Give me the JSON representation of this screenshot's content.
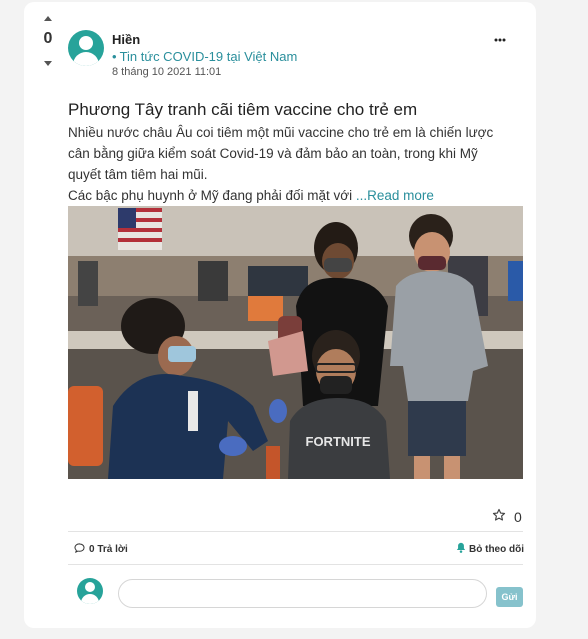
{
  "vote": {
    "count": "0"
  },
  "post": {
    "author": "Hiền",
    "category": "Tin tức COVID-19 tại Việt Nam",
    "category_bullet": "•",
    "date": "8 tháng 10 2021 11:01",
    "more_label": "•••",
    "title": "Phương Tây tranh cãi tiêm vaccine cho trẻ em",
    "excerpt_main": "Nhiều nước châu Âu coi tiêm một mũi vaccine cho trẻ em là chiến lược\ncân bằng giữa kiểm soát Covid-19 và đảm bảo an toàn, trong khi Mỹ\nquyết tâm tiêm hai mũi.",
    "excerpt_tail": "Các bậc phụ huynh ở Mỹ đang phải đối mặt với ",
    "read_more": "...Read more",
    "image_shirt_text": "FORTNITE"
  },
  "footer": {
    "like_count": "0",
    "reply_label": "0 Trả lời",
    "unfollow_label": "Bỏ theo dõi",
    "comment_placeholder": "",
    "send_label": "Gửi"
  },
  "colors": {
    "accent": "#27a39a",
    "link": "#2a8f9c",
    "send_button": "#86c2cc"
  },
  "icons": {
    "vote_up": "triangle-up-icon",
    "vote_down": "triangle-down-icon",
    "like": "star-outline-icon",
    "reply": "speech-bubble-icon",
    "unfollow": "bell-icon",
    "avatar": "user-avatar-icon"
  }
}
